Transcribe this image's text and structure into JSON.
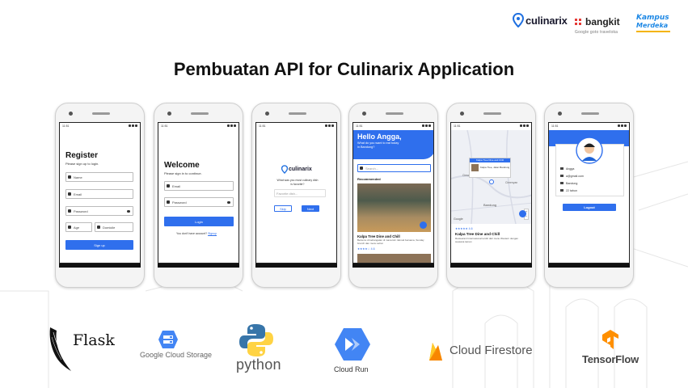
{
  "header": {
    "culinarix_logo": "culinarix",
    "bangkit_logo": "bangkit",
    "bangkit_partners": "Google  goto  traveloka",
    "kampus_line1": "Kampus",
    "kampus_line2": "Merdeka"
  },
  "title": "Pembuatan API for Culinarix Application",
  "phones": {
    "status_time": "11:51",
    "register": {
      "title": "Register",
      "subtitle": "Please sign up to login.",
      "fields": [
        "Name",
        "Email",
        "Password",
        "Age",
        "Domicile"
      ],
      "button": "Sign up"
    },
    "login": {
      "title": "Welcome",
      "subtitle": "Please sign in to continue.",
      "fields": [
        "Email",
        "Password"
      ],
      "button": "Login",
      "footer_text": "You don't have account?",
      "footer_link": "Signup"
    },
    "preference": {
      "logo": "culinarix",
      "question": "What was you most culinary dish is favorite?",
      "input_placeholder": "Favorite dish...",
      "skip": "Skip",
      "next": "Next"
    },
    "home": {
      "greeting": "Hello Angga,",
      "greeting_sub": "What do you want to eat today in Bandung?",
      "search_placeholder": "Search...",
      "section": "Recommended",
      "restaurant_name": "Kalpa Tree Dine and Chill",
      "restaurant_desc": "Bertemu di kehangatan di mana kini nikmati bersama, Sunday brunch dan menu sehat",
      "rating": "4.6"
    },
    "map": {
      "banner": "Kalpa Tree Dine and Chill",
      "popup_title": "Kalpa Tree, Jalan Bandung",
      "city": "Bandung",
      "area_left": "Cimahi",
      "area_right": "Cimenyan",
      "google": "Google",
      "rating_text": "4.6",
      "restaurant_name": "Kalpa Tree Dine and Chill",
      "restaurant_desc": "Restaurant Internasional terdiri dari menu Western dengan suasana taman"
    },
    "profile": {
      "rows": [
        "Angga",
        "a@gmail.com",
        "Bandung",
        "22 tahun"
      ],
      "button": "Logout"
    }
  },
  "tech": {
    "flask": "Flask",
    "gcs": "Google Cloud Storage",
    "python": "python",
    "cloud_run": "Cloud Run",
    "firestore": "Cloud Firestore",
    "tensorflow": "TensorFlow"
  },
  "colors": {
    "accent_blue": "#2f6fed",
    "title_text": "#111111",
    "phone_frame": "#f4f4f4"
  }
}
